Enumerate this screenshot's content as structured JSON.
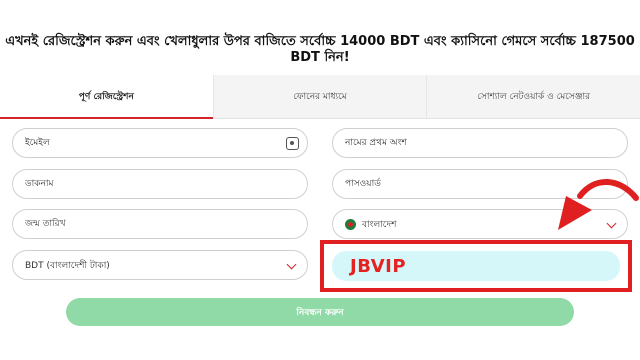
{
  "headline": "এখনই রেজিস্ট্রেশন করুন এবং খেলাধুলার উপর বাজিতে সর্বোচ্চ 14000 BDT এবং ক্যাসিনো গেমসে সর্বোচ্চ 187500 BDT নিন!",
  "tabs": [
    {
      "label": "পূর্ণ রেজিস্ট্রেশন"
    },
    {
      "label": "ফোনের মাধ্যমে"
    },
    {
      "label": "সোশ্যাল নেটওয়ার্ক ও মেসেঞ্জার"
    }
  ],
  "form": {
    "email_placeholder": "ইমেইল",
    "first_name_placeholder": "নামের প্রথম অংশ",
    "nickname_placeholder": "ডাকনাম",
    "password_placeholder": "পাসওয়ার্ড",
    "birthdate_placeholder": "জন্ম তারিখ",
    "country_value": "বাংলাদেশ",
    "currency_value": "BDT (বাংলাদেশী টাকা)",
    "promo_code_value": "JBVIP"
  },
  "submit_label": "নিবন্ধন করুন",
  "colors": {
    "accent": "#d4242b",
    "promo_highlight": "#e02020",
    "promo_bg": "#d6f7fa",
    "submit_bg": "#8fdaa6"
  },
  "icons": {
    "scan": "scan-icon",
    "chevron": "chevron-down-icon",
    "flag": "bangladesh-flag-icon",
    "arrow": "curved-arrow-icon"
  }
}
